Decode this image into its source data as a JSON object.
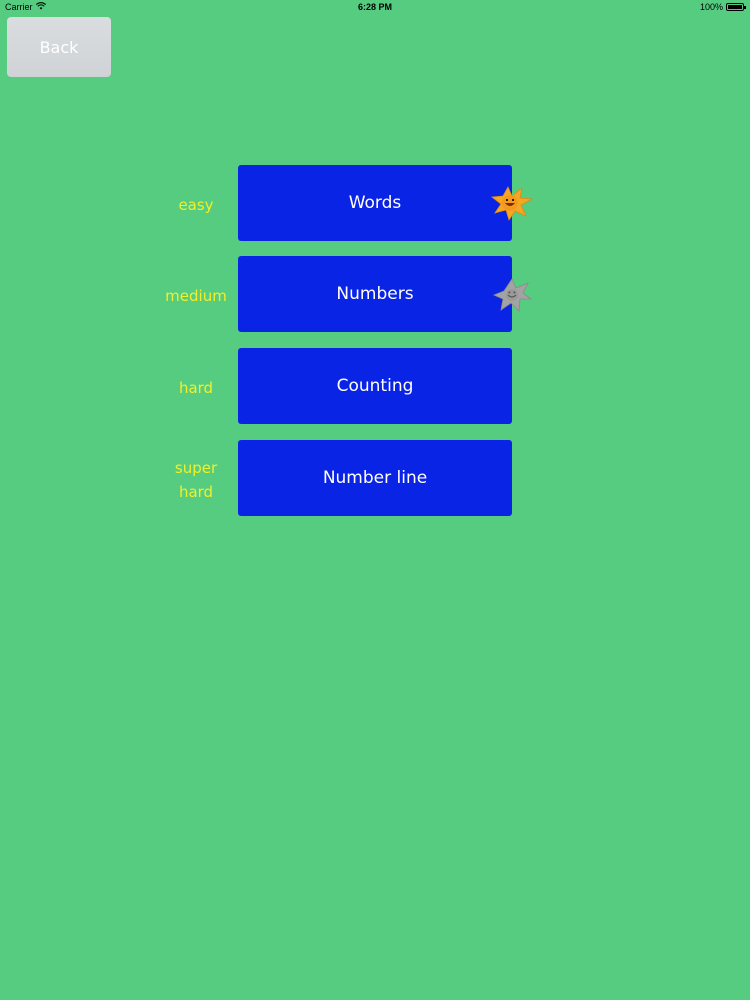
{
  "status_bar": {
    "carrier": "Carrier",
    "time": "6:28 PM",
    "battery": "100%"
  },
  "back_button": {
    "label": "Back"
  },
  "levels": [
    {
      "difficulty": "easy",
      "label": "Words",
      "star": "gold-star-icon"
    },
    {
      "difficulty": "medium",
      "label": "Numbers",
      "star": "grey-star-icon"
    },
    {
      "difficulty": "hard",
      "label": "Counting",
      "star": null
    },
    {
      "difficulty_line1": "super",
      "difficulty_line2": "hard",
      "label": "Number line",
      "star": null
    }
  ],
  "colors": {
    "background": "#55cc80",
    "button": "#0a24e6",
    "difficulty_text": "#f1f02a",
    "gold_star": "#f5a623",
    "grey_star": "#9a9a9a"
  }
}
